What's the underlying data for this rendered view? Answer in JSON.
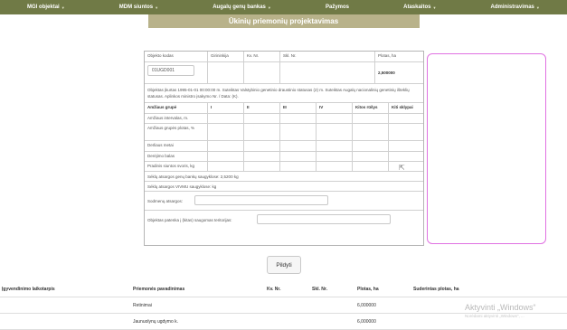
{
  "nav": {
    "items": [
      "MGI objektai",
      "MDM siuntos",
      "Augalų genų bankas",
      "Pažymos",
      "Ataskaitos",
      "Administravimas"
    ]
  },
  "page": {
    "subtitle": "Ūkinių priemonių projektavimas"
  },
  "form": {
    "header_labels": [
      "Objekto kodas",
      "Girininkija",
      "Kv. Nr.",
      "Skl. Nr.",
      "Plotas, ha"
    ],
    "object_code": "01UGD001",
    "area": "2,500000",
    "info_text": "Objektas įkurtas 1995-01-01 00:00:00 m. Suteiktas Valstybinio genetinio draustinio statusas (2) m. Suteiktas Augalų nacionalinių genetinių išteklių statusas. Aplinkos ministro įsakymo Nr. / Data: (K).",
    "age_table": {
      "headers": [
        "Amžiaus grupė",
        "I",
        "II",
        "III",
        "IV",
        "Kitos rūšys",
        "Kiti sklypai"
      ],
      "row_labels": [
        "Amžiaus intervalas, m.",
        "Amžiaus grupės plotas, %",
        "Derliaus metai",
        "Derėjimo balas",
        "Pradinis siuntos svoris, kg"
      ]
    },
    "seed_stock_gene_bank": "Sėklų atsargos genų bankų saugyklose: 2,5200 kg",
    "seed_stock_vivmu": "Sėklų atsargos VIVMU saugyklose: kg",
    "planting_stock_label": "Sodmenų atsargos:",
    "protected_area_label": "Objektas patenka į (kitas) saugomas teritorijas:",
    "submit_label": "Pildyti"
  },
  "bottom_table": {
    "headers": [
      "Įgyvendinimo laikotarpis",
      "Priemonės pavadinimas",
      "Kv. Nr.",
      "Skl. Nr.",
      "Plotas, ha",
      "Suderintas plotas, ha"
    ],
    "rows": [
      [
        "",
        "Retinimai",
        "",
        "",
        "6,000000",
        ""
      ],
      [
        "",
        "Jaunuolynų ugdymo k.",
        "",
        "",
        "6,000000",
        ""
      ]
    ]
  },
  "watermark": {
    "title": "Aktyvinti „Windows“",
    "subtitle": "Norėdami aktyvinti „Windows“, ..."
  }
}
